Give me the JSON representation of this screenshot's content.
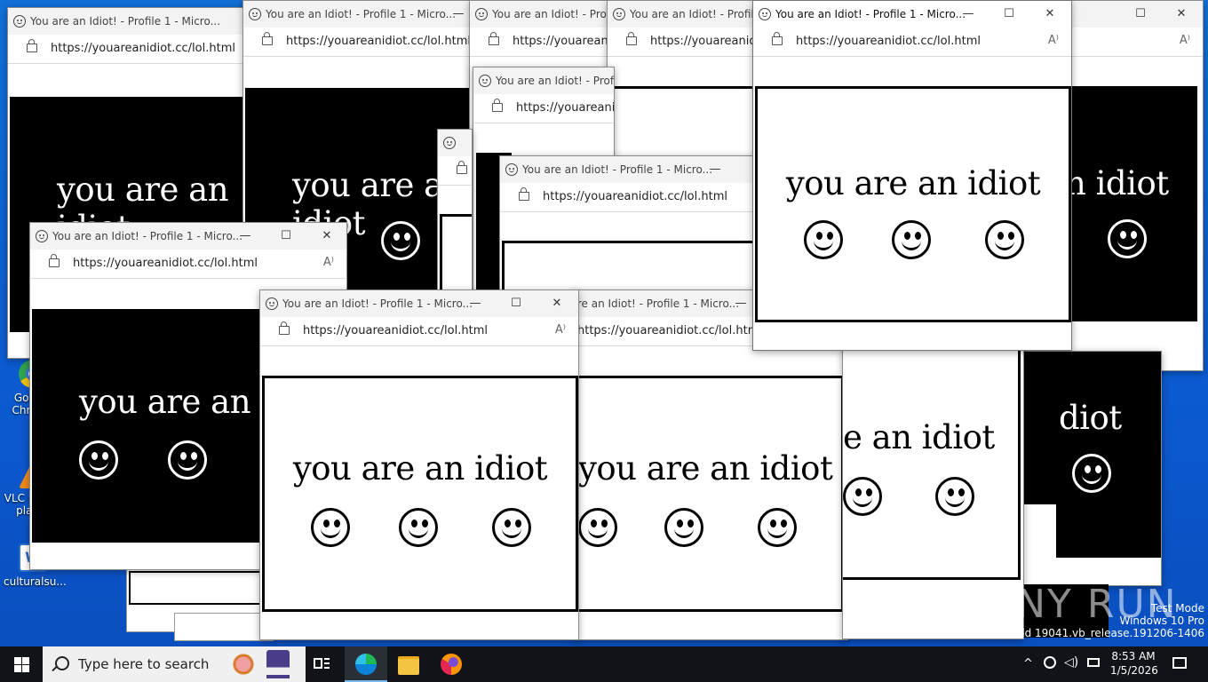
{
  "window": {
    "title": "You are an Idiot! - Profile 1 - Micro...",
    "url": "https://youareanidiot.cc/lol.html",
    "page_text": "you are an idiot",
    "min_icon": "—",
    "max_icon": "☐",
    "close_icon": "✕",
    "read_aloud_icon": "A⁾"
  },
  "desktop": {
    "icons": [
      {
        "label": "Google Chrome",
        "icon": "chrome-icon",
        "color": "#e04a3a"
      },
      {
        "label": "VLC media player",
        "icon": "vlc-icon",
        "color": "#f08a1c"
      },
      {
        "label": "culturalsu...",
        "icon": "word-doc-icon",
        "color": "#2b6fd1"
      }
    ]
  },
  "taskbar": {
    "search_placeholder": "Type here to search",
    "time": "8:53 AM",
    "date": "1/5/2026",
    "pinned": [
      "task-view-icon",
      "edge-icon",
      "file-explorer-icon",
      "firefox-icon"
    ]
  },
  "watermark": {
    "line1": "Test Mode",
    "line2": "Windows 10 Pro",
    "line3": "Build 19041.vb_release.191206-1406",
    "brand": "ANY RUN"
  },
  "colors": {
    "desktop_blue": "#0b5ad0",
    "taskbar": "#101418"
  }
}
